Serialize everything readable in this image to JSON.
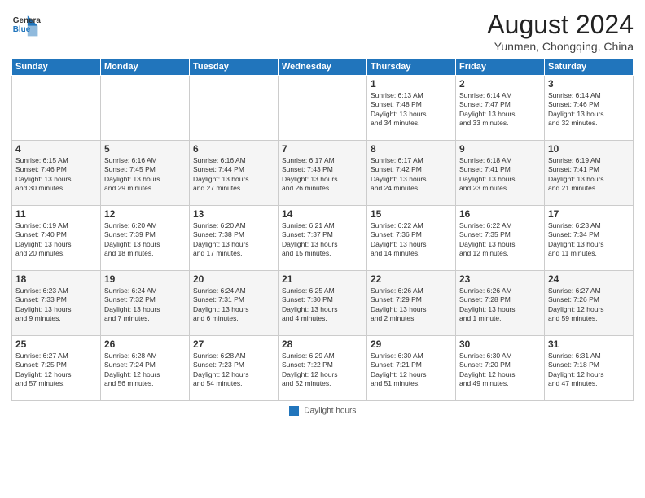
{
  "header": {
    "logo_general": "General",
    "logo_blue": "Blue",
    "month_title": "August 2024",
    "location": "Yunmen, Chongqing, China"
  },
  "weekdays": [
    "Sunday",
    "Monday",
    "Tuesday",
    "Wednesday",
    "Thursday",
    "Friday",
    "Saturday"
  ],
  "footer": {
    "label": "Daylight hours"
  },
  "weeks": [
    [
      {
        "day": "",
        "info": ""
      },
      {
        "day": "",
        "info": ""
      },
      {
        "day": "",
        "info": ""
      },
      {
        "day": "",
        "info": ""
      },
      {
        "day": "1",
        "info": "Sunrise: 6:13 AM\nSunset: 7:48 PM\nDaylight: 13 hours\nand 34 minutes."
      },
      {
        "day": "2",
        "info": "Sunrise: 6:14 AM\nSunset: 7:47 PM\nDaylight: 13 hours\nand 33 minutes."
      },
      {
        "day": "3",
        "info": "Sunrise: 6:14 AM\nSunset: 7:46 PM\nDaylight: 13 hours\nand 32 minutes."
      }
    ],
    [
      {
        "day": "4",
        "info": "Sunrise: 6:15 AM\nSunset: 7:46 PM\nDaylight: 13 hours\nand 30 minutes."
      },
      {
        "day": "5",
        "info": "Sunrise: 6:16 AM\nSunset: 7:45 PM\nDaylight: 13 hours\nand 29 minutes."
      },
      {
        "day": "6",
        "info": "Sunrise: 6:16 AM\nSunset: 7:44 PM\nDaylight: 13 hours\nand 27 minutes."
      },
      {
        "day": "7",
        "info": "Sunrise: 6:17 AM\nSunset: 7:43 PM\nDaylight: 13 hours\nand 26 minutes."
      },
      {
        "day": "8",
        "info": "Sunrise: 6:17 AM\nSunset: 7:42 PM\nDaylight: 13 hours\nand 24 minutes."
      },
      {
        "day": "9",
        "info": "Sunrise: 6:18 AM\nSunset: 7:41 PM\nDaylight: 13 hours\nand 23 minutes."
      },
      {
        "day": "10",
        "info": "Sunrise: 6:19 AM\nSunset: 7:41 PM\nDaylight: 13 hours\nand 21 minutes."
      }
    ],
    [
      {
        "day": "11",
        "info": "Sunrise: 6:19 AM\nSunset: 7:40 PM\nDaylight: 13 hours\nand 20 minutes."
      },
      {
        "day": "12",
        "info": "Sunrise: 6:20 AM\nSunset: 7:39 PM\nDaylight: 13 hours\nand 18 minutes."
      },
      {
        "day": "13",
        "info": "Sunrise: 6:20 AM\nSunset: 7:38 PM\nDaylight: 13 hours\nand 17 minutes."
      },
      {
        "day": "14",
        "info": "Sunrise: 6:21 AM\nSunset: 7:37 PM\nDaylight: 13 hours\nand 15 minutes."
      },
      {
        "day": "15",
        "info": "Sunrise: 6:22 AM\nSunset: 7:36 PM\nDaylight: 13 hours\nand 14 minutes."
      },
      {
        "day": "16",
        "info": "Sunrise: 6:22 AM\nSunset: 7:35 PM\nDaylight: 13 hours\nand 12 minutes."
      },
      {
        "day": "17",
        "info": "Sunrise: 6:23 AM\nSunset: 7:34 PM\nDaylight: 13 hours\nand 11 minutes."
      }
    ],
    [
      {
        "day": "18",
        "info": "Sunrise: 6:23 AM\nSunset: 7:33 PM\nDaylight: 13 hours\nand 9 minutes."
      },
      {
        "day": "19",
        "info": "Sunrise: 6:24 AM\nSunset: 7:32 PM\nDaylight: 13 hours\nand 7 minutes."
      },
      {
        "day": "20",
        "info": "Sunrise: 6:24 AM\nSunset: 7:31 PM\nDaylight: 13 hours\nand 6 minutes."
      },
      {
        "day": "21",
        "info": "Sunrise: 6:25 AM\nSunset: 7:30 PM\nDaylight: 13 hours\nand 4 minutes."
      },
      {
        "day": "22",
        "info": "Sunrise: 6:26 AM\nSunset: 7:29 PM\nDaylight: 13 hours\nand 2 minutes."
      },
      {
        "day": "23",
        "info": "Sunrise: 6:26 AM\nSunset: 7:28 PM\nDaylight: 13 hours\nand 1 minute."
      },
      {
        "day": "24",
        "info": "Sunrise: 6:27 AM\nSunset: 7:26 PM\nDaylight: 12 hours\nand 59 minutes."
      }
    ],
    [
      {
        "day": "25",
        "info": "Sunrise: 6:27 AM\nSunset: 7:25 PM\nDaylight: 12 hours\nand 57 minutes."
      },
      {
        "day": "26",
        "info": "Sunrise: 6:28 AM\nSunset: 7:24 PM\nDaylight: 12 hours\nand 56 minutes."
      },
      {
        "day": "27",
        "info": "Sunrise: 6:28 AM\nSunset: 7:23 PM\nDaylight: 12 hours\nand 54 minutes."
      },
      {
        "day": "28",
        "info": "Sunrise: 6:29 AM\nSunset: 7:22 PM\nDaylight: 12 hours\nand 52 minutes."
      },
      {
        "day": "29",
        "info": "Sunrise: 6:30 AM\nSunset: 7:21 PM\nDaylight: 12 hours\nand 51 minutes."
      },
      {
        "day": "30",
        "info": "Sunrise: 6:30 AM\nSunset: 7:20 PM\nDaylight: 12 hours\nand 49 minutes."
      },
      {
        "day": "31",
        "info": "Sunrise: 6:31 AM\nSunset: 7:18 PM\nDaylight: 12 hours\nand 47 minutes."
      }
    ]
  ]
}
